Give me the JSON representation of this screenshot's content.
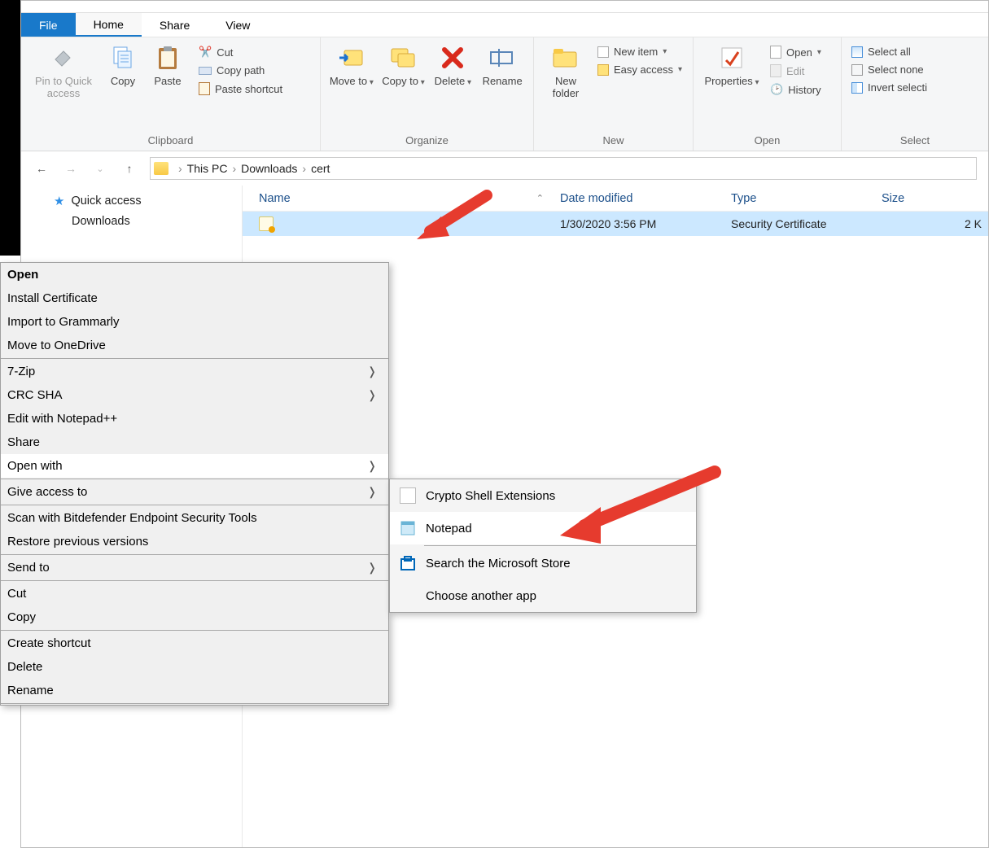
{
  "tabs": {
    "file": "File",
    "home": "Home",
    "share": "Share",
    "view": "View"
  },
  "ribbon": {
    "clipboard": {
      "label": "Clipboard",
      "pin": "Pin to Quick access",
      "copy": "Copy",
      "paste": "Paste",
      "cut": "Cut",
      "copypath": "Copy path",
      "pasteshortcut": "Paste shortcut"
    },
    "organize": {
      "label": "Organize",
      "moveto": "Move to",
      "copyto": "Copy to",
      "delete": "Delete",
      "rename": "Rename"
    },
    "new": {
      "label": "New",
      "newfolder": "New folder",
      "newitem": "New item",
      "easyaccess": "Easy access"
    },
    "open": {
      "label": "Open",
      "properties": "Properties",
      "open": "Open",
      "edit": "Edit",
      "history": "History"
    },
    "select": {
      "label": "Select",
      "all": "Select all",
      "none": "Select none",
      "invert": "Invert selecti"
    }
  },
  "breadcrumb": {
    "root": "This PC",
    "p1": "Downloads",
    "p2": "cert"
  },
  "sidebar": {
    "quick": "Quick access",
    "downloads": "Downloads"
  },
  "columns": {
    "name": "Name",
    "date": "Date modified",
    "type": "Type",
    "size": "Size"
  },
  "row": {
    "date": "1/30/2020 3:56 PM",
    "type": "Security Certificate",
    "size": "2 K"
  },
  "context": {
    "open": "Open",
    "install": "Install Certificate",
    "grammarly": "Import to Grammarly",
    "onedrive": "Move to OneDrive",
    "sevenzip": "7-Zip",
    "crcsha": "CRC SHA",
    "npp": "Edit with Notepad++",
    "share": "Share",
    "openwith": "Open with",
    "giveaccess": "Give access to",
    "bitdefender": "Scan with Bitdefender Endpoint Security Tools",
    "restore": "Restore previous versions",
    "sendto": "Send to",
    "cut": "Cut",
    "copy": "Copy",
    "shortcut": "Create shortcut",
    "delete": "Delete",
    "rename": "Rename"
  },
  "submenu": {
    "crypto": "Crypto Shell Extensions",
    "notepad": "Notepad",
    "store": "Search the Microsoft Store",
    "choose": "Choose another app"
  }
}
